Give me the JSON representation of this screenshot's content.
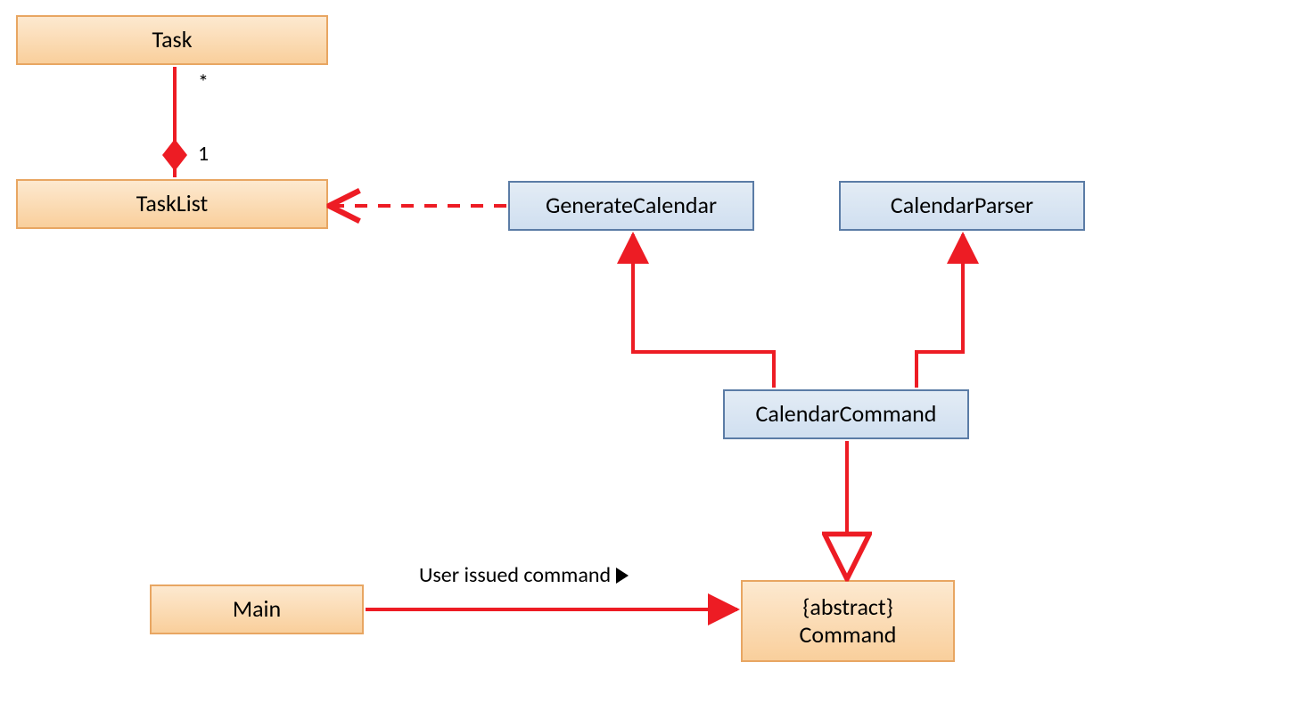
{
  "classes": {
    "task": "Task",
    "tasklist": "TaskList",
    "generateCalendar": "GenerateCalendar",
    "calendarParser": "CalendarParser",
    "calendarCommand": "CalendarCommand",
    "main": "Main",
    "commandAbstract": "{abstract}",
    "commandName": "Command"
  },
  "multiplicities": {
    "taskMany": "*",
    "tasklistOne": "1"
  },
  "labels": {
    "userIssuedCommand": "User issued command"
  },
  "colors": {
    "connector": "#ed1c24",
    "orangeBorder": "#e8a662",
    "blueBorder": "#5b7ca6"
  }
}
